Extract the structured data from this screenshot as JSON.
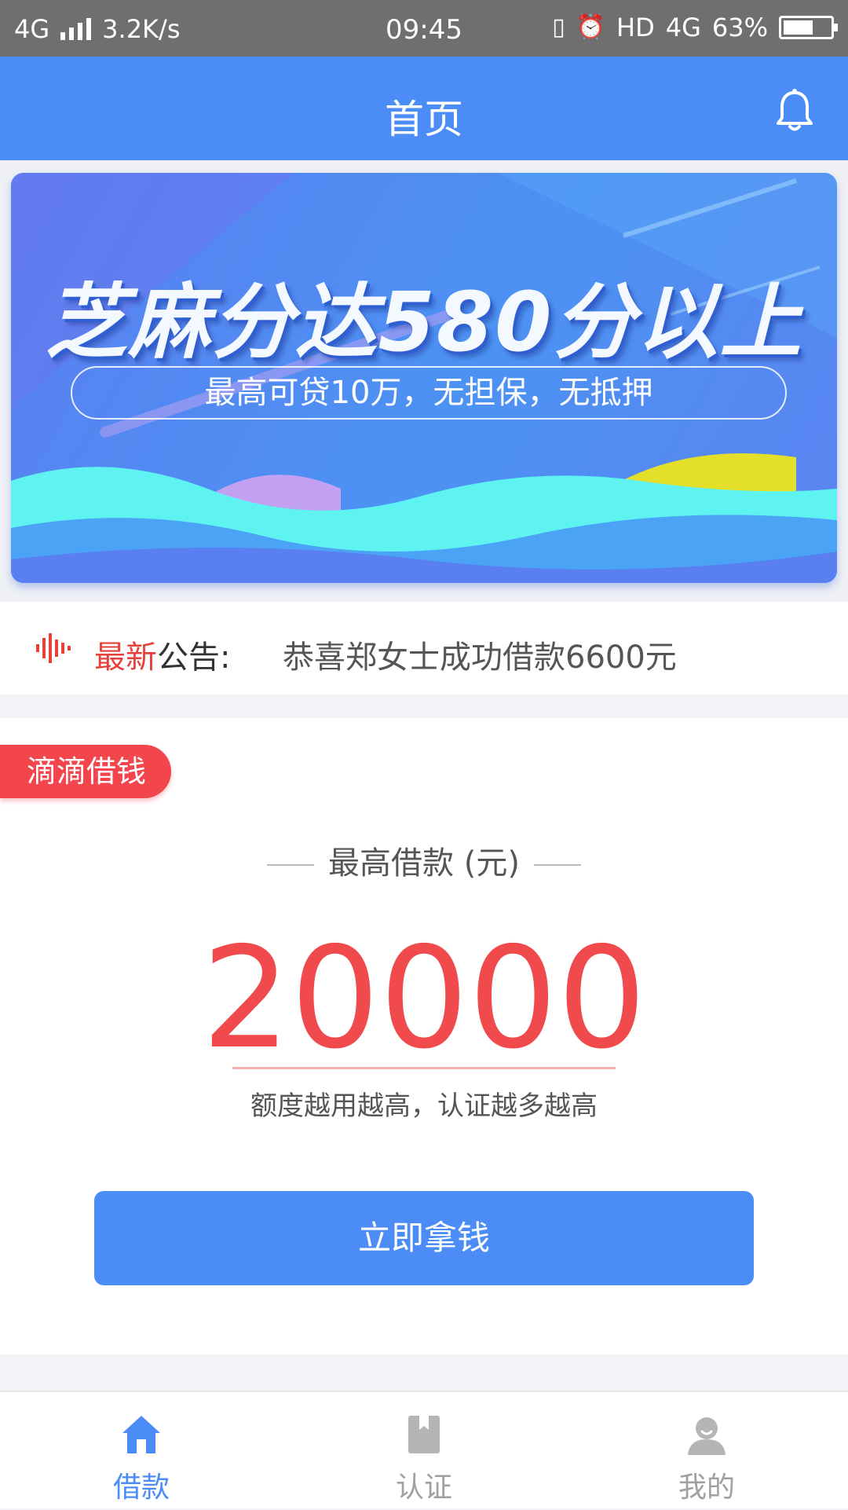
{
  "status_bar": {
    "network": "4G",
    "speed": "3.2K/s",
    "time": "09:45",
    "hd": "HD",
    "network_right": "4G",
    "battery": "63%",
    "battery_level": 0.63
  },
  "header": {
    "title": "首页"
  },
  "banner": {
    "headline": "芝麻分达580分以上",
    "subline": "最高可贷10万，无担保，无抵押"
  },
  "notice": {
    "label_red": "最新",
    "label_rest": "公告:",
    "text": "恭喜郑女士成功借款6600元"
  },
  "card": {
    "tag": "滴滴借钱",
    "subtitle": "最高借款 (元)",
    "amount": "20000",
    "hint": "额度越用越高，认证越多越高",
    "cta": "立即拿钱"
  },
  "tabbar": {
    "items": [
      {
        "label": "借款",
        "icon": "home-icon",
        "active": true
      },
      {
        "label": "认证",
        "icon": "bookmark-icon",
        "active": false
      },
      {
        "label": "我的",
        "icon": "user-icon",
        "active": false
      }
    ]
  },
  "colors": {
    "primary": "#4b8cf6",
    "accent_red": "#f14a4d",
    "status_bar": "#6f6f6f"
  }
}
